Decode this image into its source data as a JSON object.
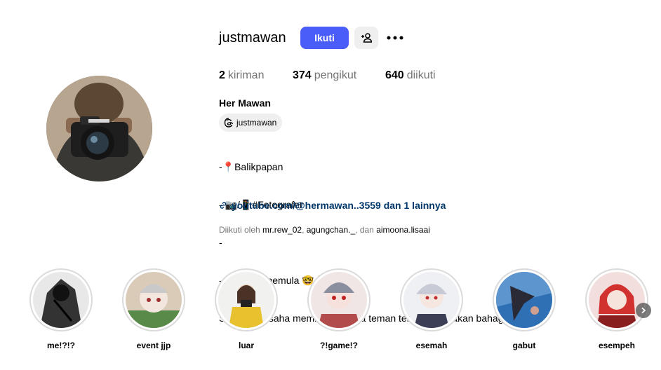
{
  "profile": {
    "username": "justmawan",
    "follow_label": "Ikuti",
    "stats": [
      {
        "count": "2",
        "label": "kiriman"
      },
      {
        "count": "374",
        "label": "pengikut"
      },
      {
        "count": "640",
        "label": "diikuti"
      }
    ],
    "full_name": "Her Mawan",
    "threads_handle": "justmawan",
    "bio_lines": [
      "-📍Balikpapan",
      "- 📷/📱#Fotografer",
      "-",
      "-cosplayer pemula 🤓👆",
      "Selalu berusaha membuat semua teman teman pasti akan bahagia 😎"
    ],
    "link_text": "youtube.com/@hermawan..3559 dan 1 lainnya",
    "followed_by": {
      "prefix": "Diikuti oleh",
      "names": [
        "mr.rew_02",
        "agungchan._"
      ],
      "and_word": "dan",
      "last_name": "aimoona.lisaai"
    }
  },
  "highlights": [
    {
      "label": "me!?!?",
      "color": "#3a3a3a"
    },
    {
      "label": "event jjp",
      "color": "#c9b6a0"
    },
    {
      "label": "luar",
      "color": "#e8c22e"
    },
    {
      "label": "?!game!?",
      "color": "#b24b4b"
    },
    {
      "label": "esemah",
      "color": "#c8cad6"
    },
    {
      "label": "gabut",
      "color": "#2f6fb4"
    },
    {
      "label": "esempeh",
      "color": "#d2322f"
    }
  ],
  "colors": {
    "accent": "#4a5df9",
    "link": "#00376b",
    "muted": "#737373"
  }
}
